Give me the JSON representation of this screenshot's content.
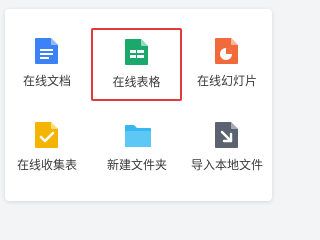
{
  "menu": {
    "items": [
      {
        "label": "在线文档",
        "icon": "doc-icon",
        "color": "#3b82f6"
      },
      {
        "label": "在线表格",
        "icon": "sheet-icon",
        "color": "#1aa86b",
        "selected": true
      },
      {
        "label": "在线幻灯片",
        "icon": "slides-icon",
        "color": "#f06a3c"
      },
      {
        "label": "在线收集表",
        "icon": "form-icon",
        "color": "#f5b400"
      },
      {
        "label": "新建文件夹",
        "icon": "folder-icon",
        "color": "#38b6f0"
      },
      {
        "label": "导入本地文件",
        "icon": "import-icon",
        "color": "#5c6370"
      }
    ]
  },
  "colors": {
    "highlight_border": "#e03a3a"
  }
}
